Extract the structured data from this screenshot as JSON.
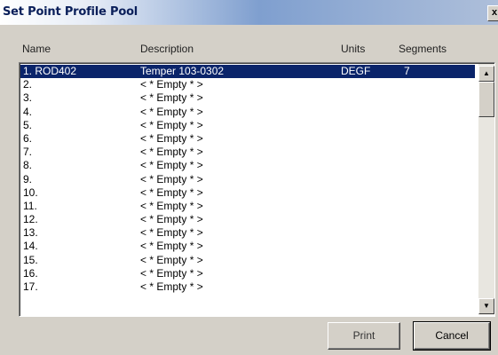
{
  "window": {
    "title": "Set Point Profile Pool",
    "close_label": "x"
  },
  "columns": {
    "name": "Name",
    "description": "Description",
    "units": "Units",
    "segments": "Segments"
  },
  "rows": [
    {
      "name": "1. ROD402",
      "description": "Temper 103-0302",
      "units": "DEGF",
      "segments": "7",
      "selected": true
    },
    {
      "name": "2.",
      "description": "< * Empty * >",
      "units": "",
      "segments": ""
    },
    {
      "name": "3.",
      "description": "< * Empty * >",
      "units": "",
      "segments": ""
    },
    {
      "name": "4.",
      "description": "< * Empty * >",
      "units": "",
      "segments": ""
    },
    {
      "name": "5.",
      "description": "< * Empty * >",
      "units": "",
      "segments": ""
    },
    {
      "name": "6.",
      "description": "< * Empty * >",
      "units": "",
      "segments": ""
    },
    {
      "name": "7.",
      "description": "< * Empty * >",
      "units": "",
      "segments": ""
    },
    {
      "name": "8.",
      "description": "< * Empty * >",
      "units": "",
      "segments": ""
    },
    {
      "name": "9.",
      "description": "< * Empty * >",
      "units": "",
      "segments": ""
    },
    {
      "name": "10.",
      "description": "< * Empty * >",
      "units": "",
      "segments": ""
    },
    {
      "name": "11.",
      "description": "< * Empty * >",
      "units": "",
      "segments": ""
    },
    {
      "name": "12.",
      "description": "< * Empty * >",
      "units": "",
      "segments": ""
    },
    {
      "name": "13.",
      "description": "< * Empty * >",
      "units": "",
      "segments": ""
    },
    {
      "name": "14.",
      "description": "< * Empty * >",
      "units": "",
      "segments": ""
    },
    {
      "name": "15.",
      "description": "< * Empty * >",
      "units": "",
      "segments": ""
    },
    {
      "name": "16.",
      "description": "< * Empty * >",
      "units": "",
      "segments": ""
    },
    {
      "name": "17.",
      "description": "< * Empty * >",
      "units": "",
      "segments": ""
    }
  ],
  "buttons": {
    "print": "Print",
    "cancel": "Cancel"
  },
  "icons": {
    "scroll_up": "scroll-up-arrow-icon",
    "scroll_down": "scroll-down-arrow-icon"
  },
  "colors": {
    "selection": "#0a246a",
    "dialog_bg": "#d4d0c8"
  }
}
